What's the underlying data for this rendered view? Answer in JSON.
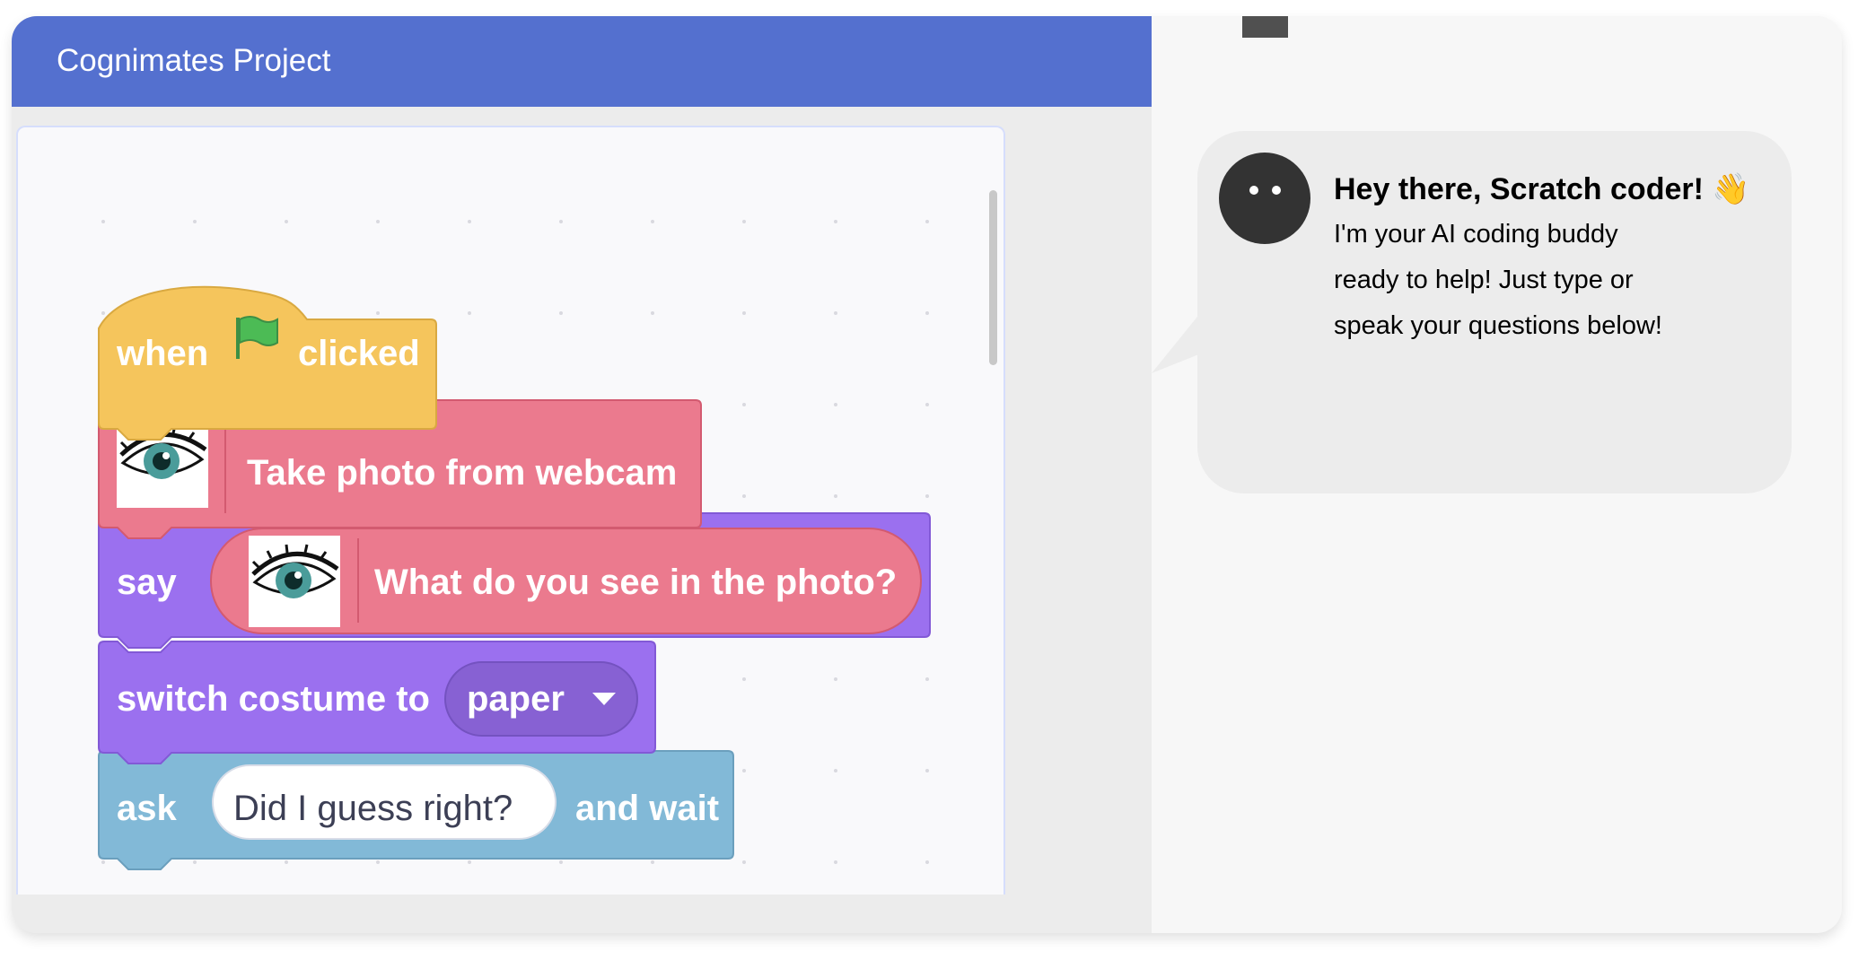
{
  "header": {
    "title": "Cognimates Project"
  },
  "blocks": {
    "hat": {
      "when": "when",
      "clicked": "clicked",
      "flag_icon": "green-flag-icon"
    },
    "photo": {
      "label": "Take photo from webcam",
      "icon": "eye-icon"
    },
    "say": {
      "label": "say",
      "reporter_text": "What do you see in the photo?",
      "icon": "eye-icon"
    },
    "costume": {
      "label": "switch costume to",
      "value": "paper"
    },
    "ask": {
      "label": "ask",
      "input": "Did I guess right?",
      "suffix": "and wait"
    }
  },
  "assistant": {
    "title": "Hey there, Scratch coder! 👋",
    "lines": [
      "I'm your AI coding buddy",
      "ready to help! Just type or",
      "speak your questions below!"
    ]
  },
  "colors": {
    "header": "#5470cf",
    "events": "#f5c55c",
    "ml_block": "#eb7a8e",
    "looks": "#9b70ef",
    "sensing": "#82b9d7"
  }
}
